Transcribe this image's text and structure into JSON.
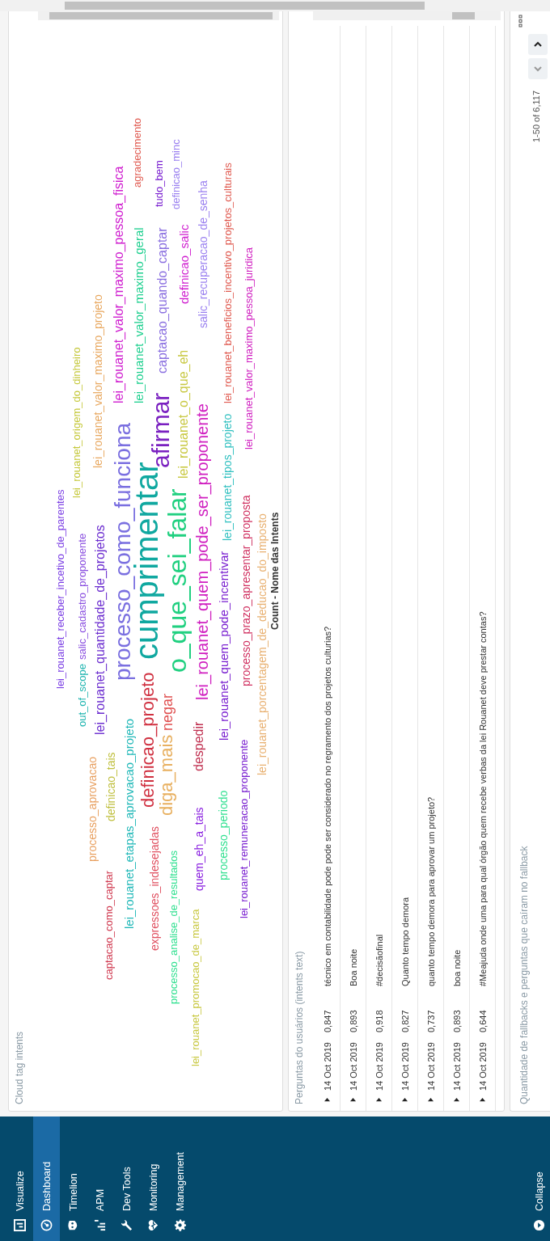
{
  "sidebar": {
    "items": [
      {
        "label": "Visualize",
        "kind": "visualize",
        "selected": false
      },
      {
        "label": "Dashboard",
        "kind": "dashboard",
        "selected": true
      },
      {
        "label": "Timelion",
        "kind": "timelion",
        "selected": false
      },
      {
        "label": "APM",
        "kind": "apm",
        "selected": false
      },
      {
        "label": "Dev Tools",
        "kind": "devtools",
        "selected": false
      },
      {
        "label": "Monitoring",
        "kind": "monitoring",
        "selected": false
      },
      {
        "label": "Management",
        "kind": "management",
        "selected": false
      }
    ],
    "collapse": "Collapse"
  },
  "cloud_panel": {
    "title": "Cloud tag intents",
    "legend_title": "Count - Nome das Intents",
    "words": [
      {
        "text": "lei_rouanet_receber_incetivo_de_parentes",
        "color": "#7b3fe4"
      },
      {
        "text": "out_of_scope",
        "color": "#1fb5b0"
      },
      {
        "text": "salic_cadastro_proponente",
        "color": "#8a4fe0"
      },
      {
        "text": "lei_rouanet_origem_do_dinheiro",
        "color": "#c5c83a"
      },
      {
        "text": "processo_aprovacao",
        "color": "#e8a060"
      },
      {
        "text": "lei_rouanet_quantidade_de_projetos",
        "color": "#6d2fd0"
      },
      {
        "text": "lei_rouanet_valor_maximo_projeto",
        "color": "#e8a860"
      },
      {
        "text": "captacao_como_captar",
        "color": "#d03a50"
      },
      {
        "text": "definicao_tais",
        "color": "#c0c040"
      },
      {
        "text": "processo_como_funciona",
        "color": "#7a6fe0"
      },
      {
        "text": "lei_rouanet_valor_maximo_pessoa_fisica",
        "color": "#d020d0"
      },
      {
        "text": "agradecimento",
        "color": "#e05a50"
      },
      {
        "text": "lei_rouanet_etapas_aprovacao_projeto",
        "color": "#20b8b8"
      },
      {
        "text": "cumprimentar",
        "color": "#10a8a0"
      },
      {
        "text": "afirmar",
        "color": "#7a20c0"
      },
      {
        "text": "lei_rouanet_valor_maximo_geral",
        "color": "#20d090"
      },
      {
        "text": "tudo_bem",
        "color": "#7a20d0"
      },
      {
        "text": "definicao_projeto",
        "color": "#d03040"
      },
      {
        "text": "expressoes_indesejadas",
        "color": "#e05060"
      },
      {
        "text": "captacao_quando_captar",
        "color": "#8a6fe0"
      },
      {
        "text": "o_que_sei_falar",
        "color": "#20d080"
      },
      {
        "text": "lei_rouanet_o_que_eh",
        "color": "#c8c840"
      },
      {
        "text": "definicao_salic",
        "color": "#d020d0"
      },
      {
        "text": "definicao_minc",
        "color": "#9a80f0"
      },
      {
        "text": "diga_mais",
        "color": "#e8b060"
      },
      {
        "text": "negar",
        "color": "#e05050"
      },
      {
        "text": "processo_analise_de_resultados",
        "color": "#30e090"
      },
      {
        "text": "lei_rouanet_quem_pode_ser_proponente",
        "color": "#d020c0"
      },
      {
        "text": "salic_recuperacao_de_senha",
        "color": "#9a80f0"
      },
      {
        "text": "quem_eh_a_tais",
        "color": "#8a20e0"
      },
      {
        "text": "despedir",
        "color": "#c03050"
      },
      {
        "text": "lei_rouanet_promocao_de_marca",
        "color": "#c8c840"
      },
      {
        "text": "lei_rouanet_tipos_projeto",
        "color": "#30c0c0"
      },
      {
        "text": "lei_rouanet_quem_pode_incentivar",
        "color": "#7a20d0"
      },
      {
        "text": "processo_periodo",
        "color": "#30e090"
      },
      {
        "text": "lei_rouanet_beneficios_incentivo_projetos_culturais",
        "color": "#e05a50"
      },
      {
        "text": "lei_rouanet_remuneracao_proponente",
        "color": "#7a20d0"
      },
      {
        "text": "processo_prazo_apresentar_proposta",
        "color": "#d03060"
      },
      {
        "text": "lei_rouanet_valor_maximo_pessoa_juridica",
        "color": "#d020c0"
      },
      {
        "text": "lei_rouanet_porcentagem_de_deducao_do_imposto",
        "color": "#e8b070"
      }
    ]
  },
  "questions_panel": {
    "title": "Perguntas do usuários (intents text)",
    "rows": [
      {
        "expanded": false,
        "date": "14 Oct 2019",
        "score": "0,847",
        "text": "técnico em contabilidade pode pode ser considerado no regramento dos projetos culturias?"
      },
      {
        "expanded": false,
        "date": "14 Oct 2019",
        "score": "0,893",
        "text": "Boa noite"
      },
      {
        "expanded": false,
        "date": "14 Oct 2019",
        "score": "0,918",
        "text": "#decisãofinal"
      },
      {
        "expanded": false,
        "date": "14 Oct 2019",
        "score": "0,827",
        "text": "Quanto tempo demora"
      },
      {
        "expanded": false,
        "date": "14 Oct 2019",
        "score": "0,737",
        "text": "quanto tempo demora para aprovar um projeto?"
      },
      {
        "expanded": false,
        "date": "14 Oct 2019",
        "score": "0,893",
        "text": "boa noite"
      },
      {
        "expanded": false,
        "date": "14 Oct 2019",
        "score": "0,644",
        "text": "#Meajuda onde uma para qual órgão quem recebe verbas da lei Rouanet deve prestar contas?"
      }
    ]
  },
  "fallback_panel": {
    "title": "Quantidade de fallbacks e perguntas que caíram no fallback",
    "pagination": "1-50 of 6,117"
  }
}
